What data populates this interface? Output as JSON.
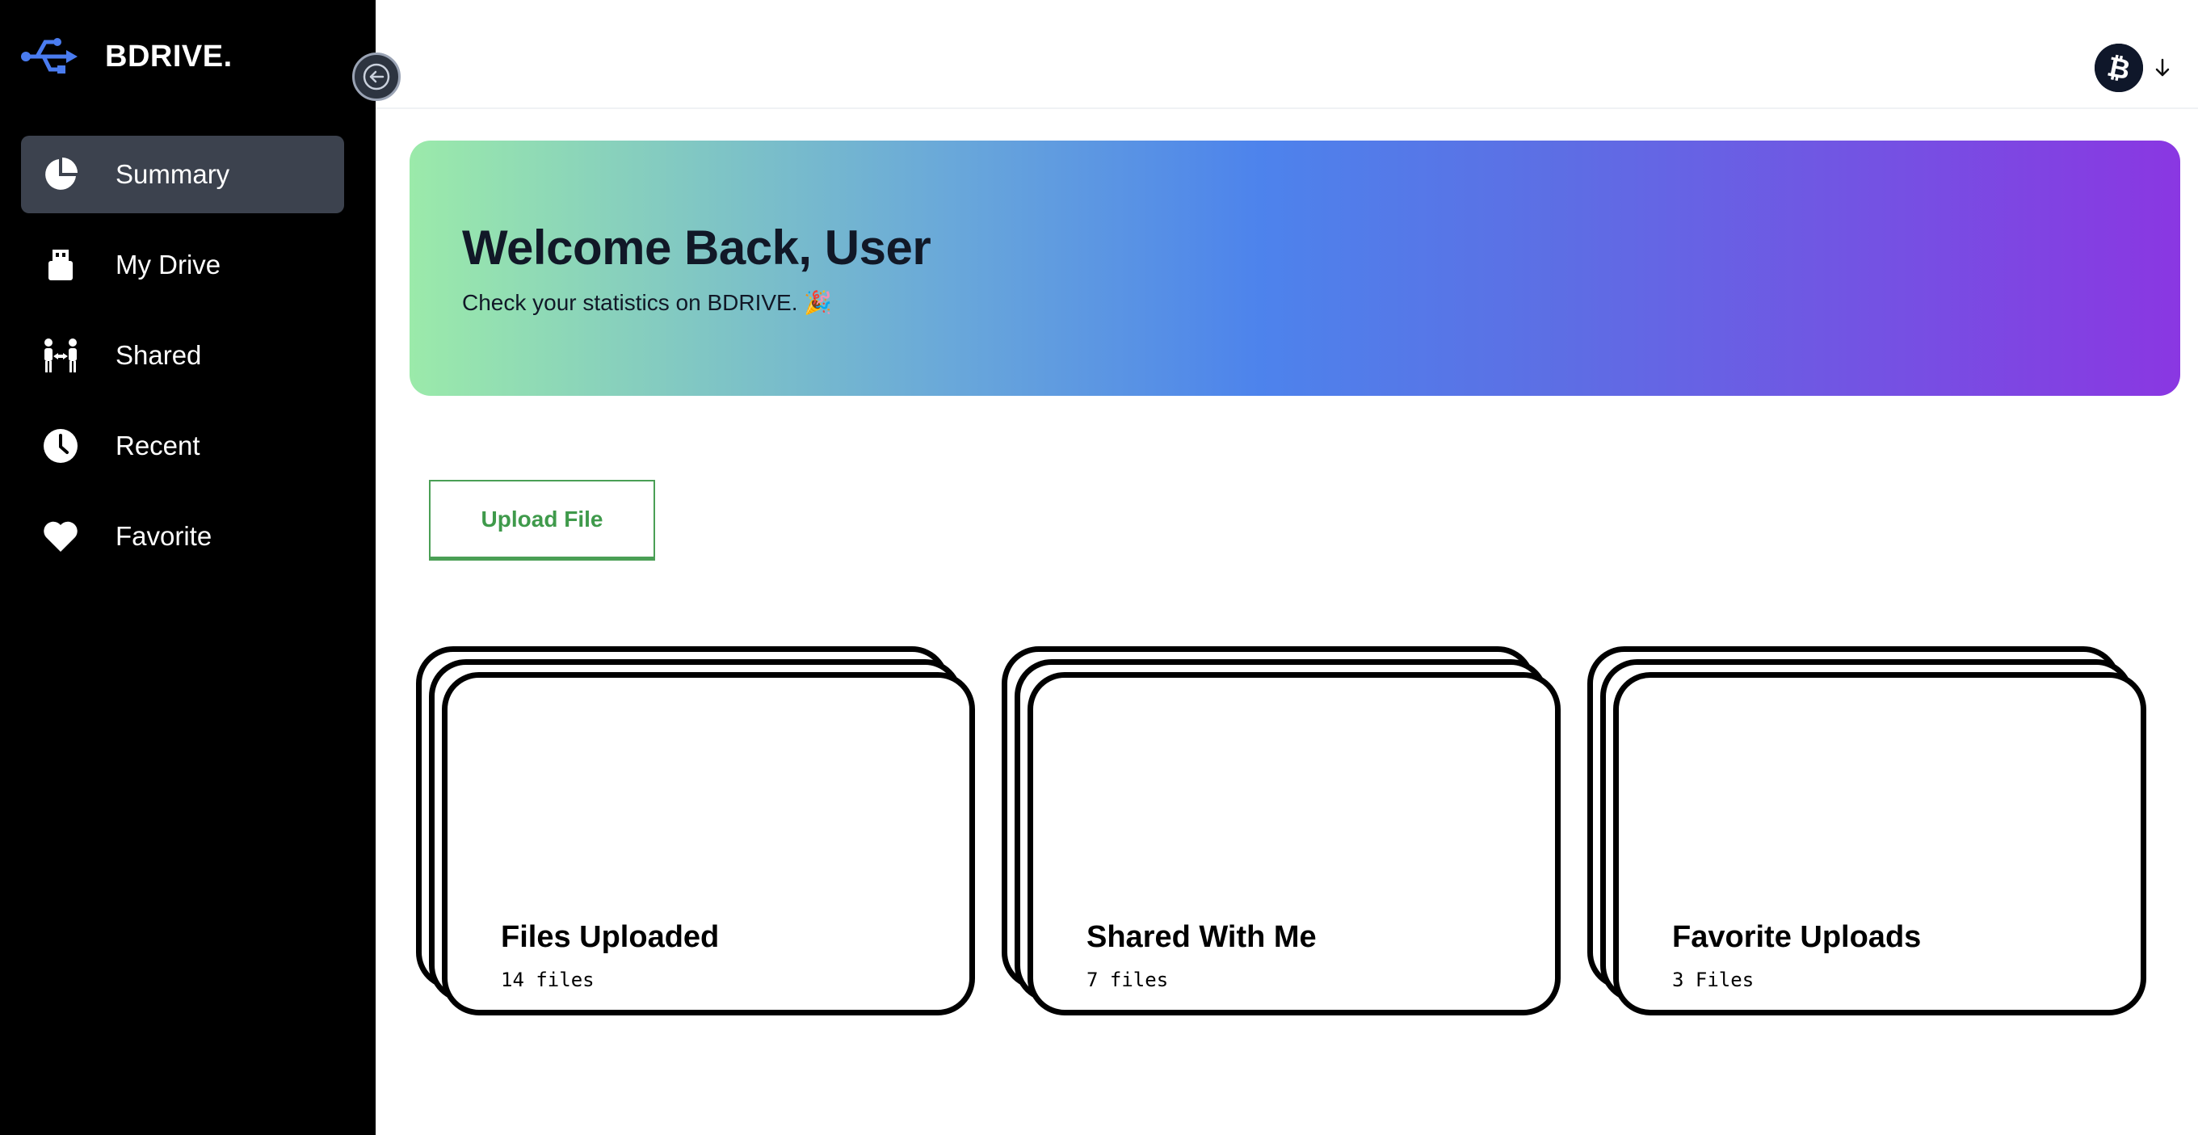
{
  "brand": {
    "name": "BDRIVE.",
    "icon": "usb-icon",
    "icon_color": "#4a7cf0"
  },
  "sidebar": {
    "background": "#000000",
    "active_color": "#3c424e",
    "items": [
      {
        "label": "Summary",
        "icon": "pie-chart-icon",
        "active": true
      },
      {
        "label": "My Drive",
        "icon": "usb-drive-icon",
        "active": false
      },
      {
        "label": "Shared",
        "icon": "people-share-icon",
        "active": false
      },
      {
        "label": "Recent",
        "icon": "clock-icon",
        "active": false
      },
      {
        "label": "Favorite",
        "icon": "heart-icon",
        "active": false
      }
    ]
  },
  "topbar": {
    "avatar_icon": "bitcoin-icon",
    "dropdown_icon": "arrow-down-icon"
  },
  "hero": {
    "title": "Welcome Back, User",
    "subtitle": "Check your statistics on BDRIVE. 🎉"
  },
  "upload": {
    "label": "Upload File",
    "color": "#3f9a4b"
  },
  "cards": [
    {
      "title": "Files Uploaded",
      "count": "14 files"
    },
    {
      "title": "Shared With Me",
      "count": "7 files"
    },
    {
      "title": "Favorite Uploads",
      "count": "3 Files"
    }
  ]
}
